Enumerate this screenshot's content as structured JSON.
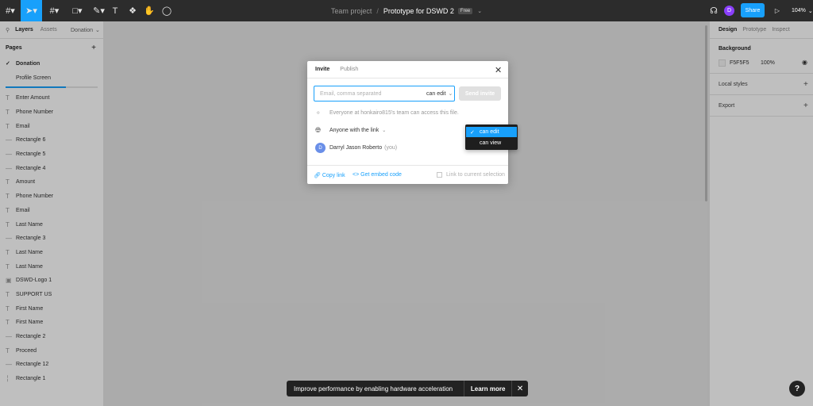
{
  "topbar": {
    "project": "Team project",
    "separator": "/",
    "file_name": "Prototype for DSWD 2",
    "plan_badge": "Free",
    "share_label": "Share",
    "user_initial": "D",
    "zoom": "104%"
  },
  "left_panel": {
    "tabs": [
      {
        "label": "Layers",
        "active": true
      },
      {
        "label": "Assets",
        "active": false
      }
    ],
    "current_page_selector": "Donation",
    "pages_heading": "Pages",
    "pages": [
      {
        "label": "Donation",
        "current": true
      },
      {
        "label": "Profile Screen",
        "current": false
      }
    ],
    "layers": [
      {
        "label": "Enter Amount",
        "icon": "text-icon"
      },
      {
        "label": "Phone Number",
        "icon": "text-icon"
      },
      {
        "label": "Email",
        "icon": "text-icon"
      },
      {
        "label": "Rectangle 6",
        "icon": "rectangle-icon"
      },
      {
        "label": "Rectangle 5",
        "icon": "rectangle-icon"
      },
      {
        "label": "Rectangle 4",
        "icon": "rectangle-icon"
      },
      {
        "label": "Amount",
        "icon": "text-icon"
      },
      {
        "label": "Phone Number",
        "icon": "text-icon"
      },
      {
        "label": "Email",
        "icon": "text-icon"
      },
      {
        "label": "Last Name",
        "icon": "text-icon"
      },
      {
        "label": "Rectangle 3",
        "icon": "rectangle-icon"
      },
      {
        "label": "Last Name",
        "icon": "text-icon"
      },
      {
        "label": "Last Name",
        "icon": "text-icon"
      },
      {
        "label": "DSWD-Logo 1",
        "icon": "image-icon"
      },
      {
        "label": "SUPPORT US",
        "icon": "text-icon"
      },
      {
        "label": "First Name",
        "icon": "text-icon"
      },
      {
        "label": "First Name",
        "icon": "text-icon"
      },
      {
        "label": "Rectangle 2",
        "icon": "rectangle-icon"
      },
      {
        "label": "Proceed",
        "icon": "text-icon"
      },
      {
        "label": "Rectangle 12",
        "icon": "rectangle-icon"
      },
      {
        "label": "Rectangle 1",
        "icon": "frame-icon"
      }
    ]
  },
  "right_panel": {
    "tabs": [
      {
        "label": "Design",
        "active": true
      },
      {
        "label": "Prototype",
        "active": false
      },
      {
        "label": "Inspect",
        "active": false
      }
    ],
    "background": {
      "heading": "Background",
      "hex": "F5F5F5",
      "opacity": "100%",
      "color": "#F5F5F5"
    },
    "local_styles": "Local styles",
    "export": "Export"
  },
  "modal": {
    "tabs": [
      {
        "label": "Invite",
        "active": true
      },
      {
        "label": "Publish",
        "active": false
      }
    ],
    "invite_placeholder": "Email, comma separated",
    "invite_permission": "can edit",
    "send_label": "Send invite",
    "team_access": "Everyone at honkairo815's team can access this file.",
    "link_access": "Anyone with the link",
    "user": {
      "initial": "D",
      "name": "Darryl Jason Roberto",
      "you": "(you)"
    },
    "copy_link": "Copy link",
    "embed_code": "Get embed code",
    "link_to_selection": "Link to current selection"
  },
  "dropdown": {
    "selected": "can edit",
    "option": "can view"
  },
  "toast": {
    "message": "Improve performance by enabling hardware acceleration",
    "action": "Learn more"
  },
  "help": "?",
  "colors": {
    "accent": "#18A0FB",
    "toolbar": "#2C2C2C",
    "avatar": "#8A3FFC"
  }
}
